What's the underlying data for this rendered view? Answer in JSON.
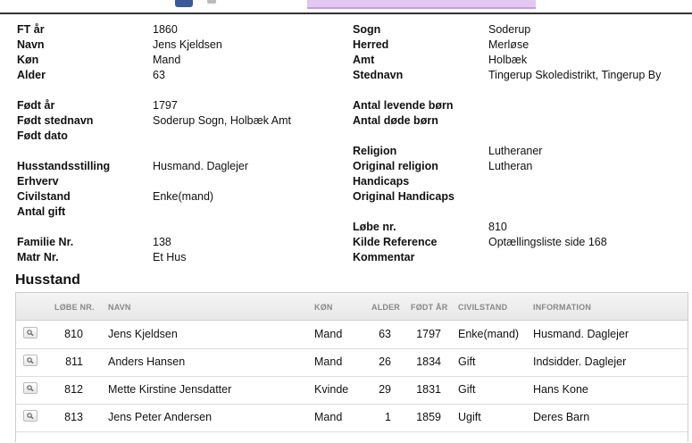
{
  "person": {
    "left": [
      {
        "label": "FT år",
        "value": "1860"
      },
      {
        "label": "Navn",
        "value": "Jens Kjeldsen"
      },
      {
        "label": "Køn",
        "value": "Mand"
      },
      {
        "label": "Alder",
        "value": "63"
      },
      {
        "label": "Født år",
        "value": "1797"
      },
      {
        "label": "Født stednavn",
        "value": "Soderup Sogn, Holbæk Amt"
      },
      {
        "label": "Født dato",
        "value": ""
      },
      {
        "label": "Husstandsstilling",
        "value": "Husmand. Daglejer"
      },
      {
        "label": "Erhverv",
        "value": ""
      },
      {
        "label": "Civilstand",
        "value": "Enke(mand)"
      },
      {
        "label": "Antal gift",
        "value": ""
      },
      {
        "label": "Familie Nr.",
        "value": "138"
      },
      {
        "label": "Matr Nr.",
        "value": "Et Hus"
      }
    ],
    "right": [
      {
        "label": "Sogn",
        "value": "Soderup"
      },
      {
        "label": "Herred",
        "value": "Merløse"
      },
      {
        "label": "Amt",
        "value": "Holbæk"
      },
      {
        "label": "Stednavn",
        "value": "Tingerup Skoledistrikt, Tingerup By"
      },
      {
        "label": "Antal levende børn",
        "value": ""
      },
      {
        "label": "Antal døde børn",
        "value": ""
      },
      {
        "label": "Religion",
        "value": "Lutheraner"
      },
      {
        "label": "Original religion",
        "value": "Lutheran"
      },
      {
        "label": "Handicaps",
        "value": ""
      },
      {
        "label": "Original Handicaps",
        "value": ""
      },
      {
        "label": "Løbe nr.",
        "value": "810"
      },
      {
        "label": "Kilde Reference",
        "value": "Optællingsliste side 168"
      },
      {
        "label": "Kommentar",
        "value": ""
      }
    ]
  },
  "household": {
    "title": "Husstand",
    "columns": [
      "LØBE NR.",
      "NAVN",
      "KØN",
      "ALDER",
      "FØDT ÅR",
      "CIVILSTAND",
      "INFORMATION"
    ],
    "rows": [
      [
        "810",
        "Jens Kjeldsen",
        "Mand",
        "63",
        "1797",
        "Enke(mand)",
        "Husmand. Daglejer"
      ],
      [
        "811",
        "Anders Hansen",
        "Mand",
        "26",
        "1834",
        "Gift",
        "Indsidder. Daglejer"
      ],
      [
        "812",
        "Mette Kirstine Jensdatter",
        "Kvinde",
        "29",
        "1831",
        "Gift",
        "Hans Kone"
      ],
      [
        "813",
        "Jens Peter Andersen",
        "Mand",
        "1",
        "1859",
        "Ugift",
        "Deres Barn"
      ]
    ]
  },
  "icons": {
    "row_view": "magnifier-icon",
    "top_left": "facebook-icon"
  }
}
